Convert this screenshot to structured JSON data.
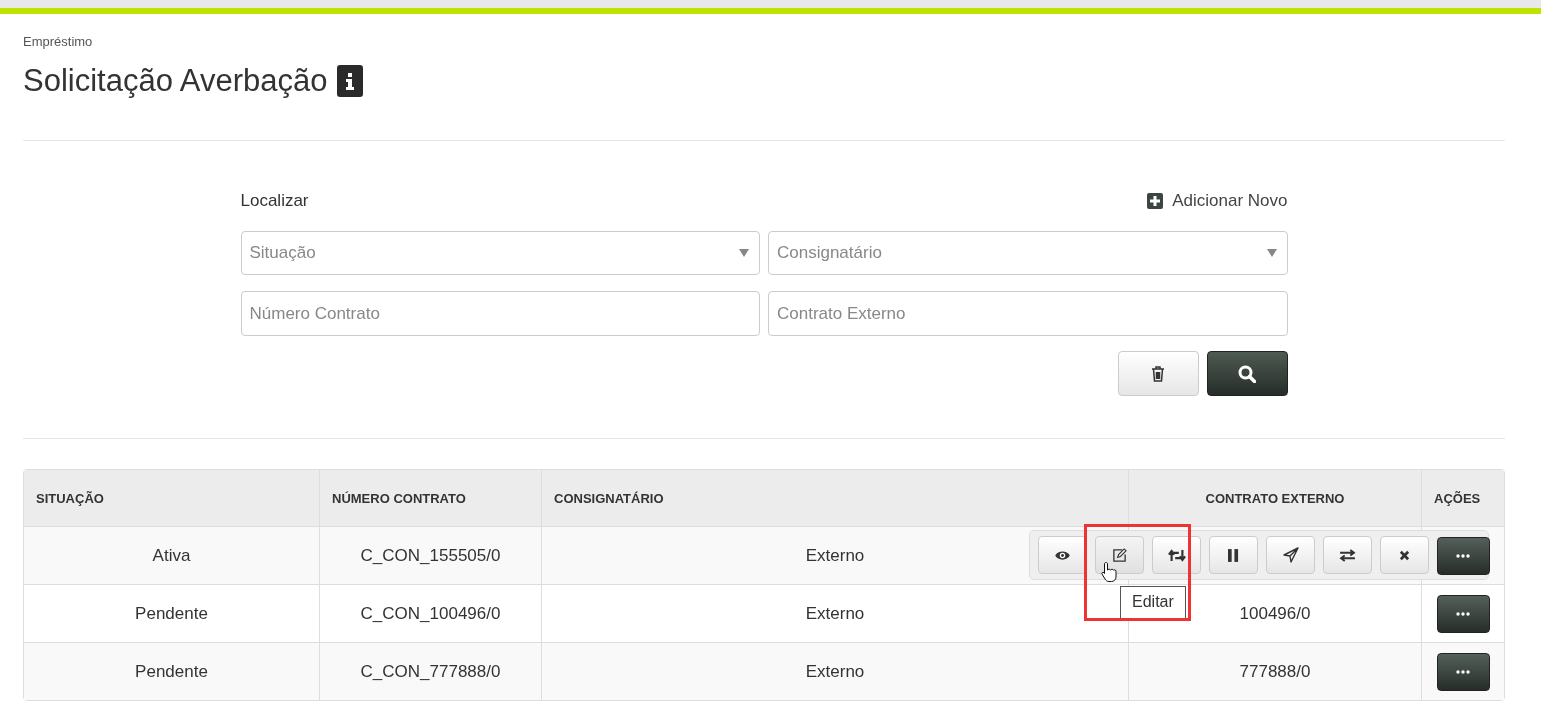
{
  "breadcrumb": "Empréstimo",
  "title": "Solicitação Averbação",
  "filter": {
    "label": "Localizar",
    "add_label": "Adicionar Novo",
    "selects": [
      {
        "placeholder": "Situação"
      },
      {
        "placeholder": "Consignatário"
      }
    ],
    "inputs": [
      {
        "placeholder": "Número Contrato"
      },
      {
        "placeholder": "Contrato Externo"
      }
    ]
  },
  "table": {
    "columns": [
      "SITUAÇÃO",
      "NÚMERO CONTRATO",
      "CONSIGNATÁRIO",
      "CONTRATO EXTERNO",
      "AÇÕES"
    ],
    "rows": [
      {
        "situacao": "Ativa",
        "numero": "C_CON_155505/0",
        "consignatario": "Externo",
        "actions_open": true
      },
      {
        "situacao": "Pendente",
        "numero": "C_CON_100496/0",
        "consignatario": "Externo",
        "externo": "100496/0",
        "actions_open": false
      },
      {
        "situacao": "Pendente",
        "numero": "C_CON_777888/0",
        "consignatario": "Externo",
        "externo": "777888/0",
        "actions_open": false
      }
    ]
  },
  "row_actions": [
    {
      "kind": "view",
      "hovered": false
    },
    {
      "kind": "edit",
      "hovered": true,
      "tooltip": "Editar"
    },
    {
      "kind": "renew",
      "hovered": false
    },
    {
      "kind": "pause",
      "hovered": false
    },
    {
      "kind": "send",
      "hovered": false
    },
    {
      "kind": "transfer",
      "hovered": false
    },
    {
      "kind": "cancel",
      "hovered": false
    }
  ]
}
